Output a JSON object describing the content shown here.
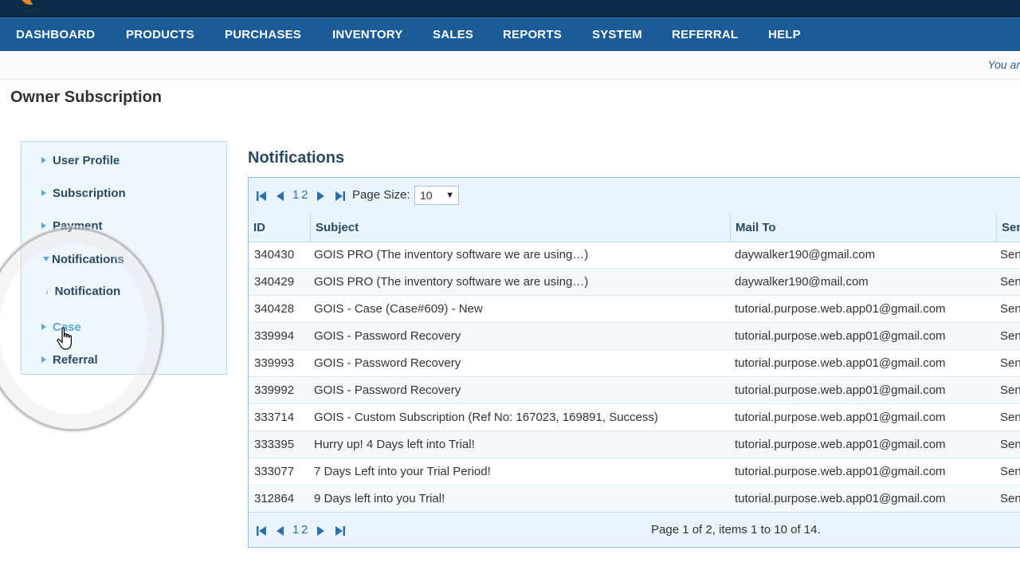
{
  "nav": {
    "items": [
      "DASHBOARD",
      "PRODUCTS",
      "PURCHASES",
      "INVENTORY",
      "SALES",
      "REPORTS",
      "SYSTEM",
      "REFERRAL",
      "HELP"
    ]
  },
  "infobar": {
    "welcome_text": "You ar"
  },
  "page": {
    "title": "Owner Subscription"
  },
  "sidebar": {
    "items": [
      "User Profile",
      "Subscription",
      "Payment",
      "Notifications",
      "Notification",
      "Case",
      "Referral"
    ]
  },
  "notifications": {
    "heading": "Notifications",
    "pager": {
      "pages": [
        "1",
        "2"
      ],
      "page_size_label": "Page Size:",
      "page_size_value": "10",
      "page_info": "Page 1 of 2, items 1 to 10 of 14."
    },
    "columns": [
      "ID",
      "Subject",
      "Mail To",
      "Sen"
    ],
    "rows": [
      {
        "id": "340430",
        "subject": "GOIS PRO (The inventory software we are using…)",
        "mail_to": "daywalker190@gmail.com",
        "sent": "Sen"
      },
      {
        "id": "340429",
        "subject": "GOIS PRO (The inventory software we are using…)",
        "mail_to": "daywalker190@mail.com",
        "sent": "Sen"
      },
      {
        "id": "340428",
        "subject": "GOIS - Case (Case#609) - New",
        "mail_to": "tutorial.purpose.web.app01@gmail.com",
        "sent": "Sen"
      },
      {
        "id": "339994",
        "subject": "GOIS - Password Recovery",
        "mail_to": "tutorial.purpose.web.app01@gmail.com",
        "sent": "Sen"
      },
      {
        "id": "339993",
        "subject": "GOIS - Password Recovery",
        "mail_to": "tutorial.purpose.web.app01@gmail.com",
        "sent": "Sen"
      },
      {
        "id": "339992",
        "subject": "GOIS - Password Recovery",
        "mail_to": "tutorial.purpose.web.app01@gmail.com",
        "sent": "Sen"
      },
      {
        "id": "333714",
        "subject": "GOIS - Custom Subscription (Ref No: 167023, 169891, Success)",
        "mail_to": "tutorial.purpose.web.app01@gmail.com",
        "sent": "Sen"
      },
      {
        "id": "333395",
        "subject": "Hurry up! 4 Days left into Trial!",
        "mail_to": "tutorial.purpose.web.app01@gmail.com",
        "sent": "Sen"
      },
      {
        "id": "333077",
        "subject": "7 Days Left into your Trial Period!",
        "mail_to": "tutorial.purpose.web.app01@gmail.com",
        "sent": "Sen"
      },
      {
        "id": "312864",
        "subject": "9 Days left into you Trial!",
        "mail_to": "tutorial.purpose.web.app01@gmail.com",
        "sent": "Sen"
      }
    ]
  },
  "colors": {
    "nav_bg": "#1b5c96",
    "top_bg": "#0b2a45",
    "accent": "#5aa9dc"
  },
  "icons": [
    "first-page-icon",
    "prev-page-icon",
    "next-page-icon",
    "last-page-icon",
    "hand-cursor-icon"
  ]
}
